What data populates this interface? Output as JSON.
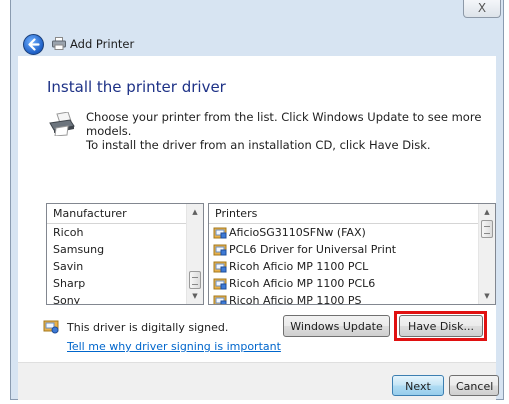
{
  "window": {
    "title": "Add Printer",
    "close_glyph": "X"
  },
  "icons": {
    "back": "back-arrow-icon",
    "printer_small": "printer-icon",
    "printer_large": "printer-icon",
    "shield": "driver-signed-icon",
    "printer_list_item": "printer-driver-icon"
  },
  "page": {
    "heading": "Install the printer driver",
    "description": "Choose your printer from the list. Click Windows Update to see more models.",
    "cd_hint": "To install the driver from an installation CD, click Have Disk."
  },
  "manufacturer_list": {
    "header": "Manufacturer",
    "items": [
      "Ricoh",
      "Samsung",
      "Savin",
      "Sharp",
      "Sony"
    ]
  },
  "printer_list": {
    "header": "Printers",
    "items": [
      "AficioSG3110SFNw (FAX)",
      "PCL6 Driver for Universal Print",
      "Ricoh Aficio MP 1100 PCL",
      "Ricoh Aficio MP 1100 PCL6",
      "Ricoh Aficio MP 1100 PS"
    ]
  },
  "signing": {
    "status_text": "This driver is digitally signed.",
    "link_text": "Tell me why driver signing is important"
  },
  "buttons": {
    "windows_update": "Windows Update",
    "have_disk": "Have Disk...",
    "next": "Next",
    "cancel": "Cancel"
  },
  "colors": {
    "heading": "#1e3287",
    "link": "#0066cc",
    "highlight_outline": "#e01010"
  }
}
